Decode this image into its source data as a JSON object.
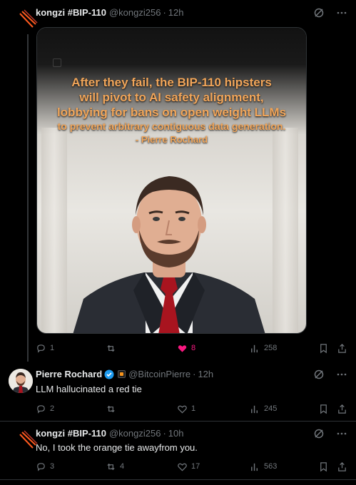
{
  "colors": {
    "background": "#000000",
    "text": "#e7e9ea",
    "muted": "#71767b",
    "like": "#f91880",
    "verified": "#1d9bf0",
    "quote": "#f2a65a"
  },
  "tweet1": {
    "name": "kongzi #BIP-110",
    "handle": "@kongzi256",
    "time": "12h",
    "media": {
      "quote_line1": "After they fail, the BIP-110 hipsters",
      "quote_line2": "will pivot to AI safety alignment,",
      "quote_line3": "lobbying for bans on open weight LLMs",
      "quote_line4": "to prevent arbitrary contiguous data generation.",
      "quote_line5": "- Pierre Rochard"
    },
    "actions": {
      "replies": "1",
      "reposts": "",
      "likes": "8",
      "views": "258"
    }
  },
  "tweet2": {
    "name": "Pierre Rochard",
    "handle": "@BitcoinPierre",
    "time": "12h",
    "text": "LLM hallucinated a red tie",
    "actions": {
      "replies": "2",
      "reposts": "",
      "likes": "1",
      "views": "245"
    }
  },
  "tweet3": {
    "name": "kongzi #BIP-110",
    "handle": "@kongzi256",
    "time": "10h",
    "text": "No, I took the orange tie awayfrom you.",
    "actions": {
      "replies": "3",
      "reposts": "4",
      "likes": "17",
      "views": "563"
    }
  },
  "icons": [
    "grok-icon",
    "more-icon",
    "reply-icon",
    "repost-icon",
    "like-icon",
    "views-icon",
    "bookmark-icon",
    "share-icon",
    "verified-badge-icon",
    "affiliate-badge-icon"
  ]
}
